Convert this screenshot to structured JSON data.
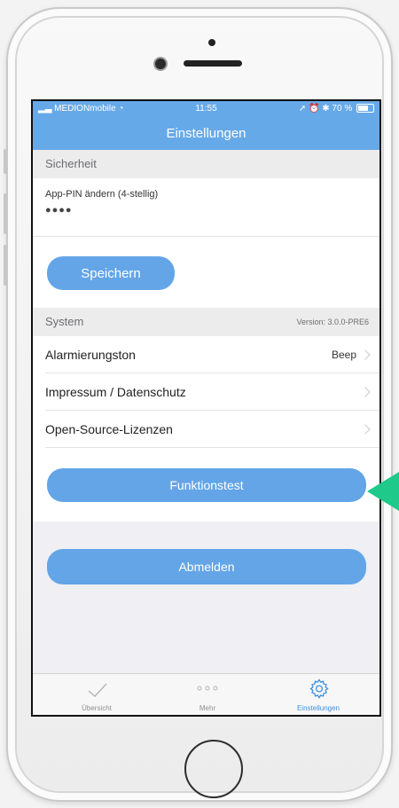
{
  "status_bar": {
    "carrier": "MEDIONmobile",
    "time": "11:55",
    "battery": "70 %",
    "battery_level": 0.7
  },
  "nav": {
    "title": "Einstellungen"
  },
  "security_section": {
    "header": "Sicherheit",
    "pin_label": "App-PIN ändern (4-stellig)",
    "pin_value": "●●●●",
    "save_button": "Speichern"
  },
  "system_section": {
    "header": "System",
    "version": "Version: 3.0.0-PRE6",
    "rows": [
      {
        "label": "Alarmierungston",
        "detail": "Beep"
      },
      {
        "label": "Impressum / Datenschutz",
        "detail": ""
      },
      {
        "label": "Open-Source-Lizenzen",
        "detail": ""
      }
    ],
    "test_button": "Funktionstest"
  },
  "logout_button": "Abmelden",
  "tabs": [
    {
      "label": "Übersicht",
      "icon": "checkmark-icon"
    },
    {
      "label": "Mehr",
      "icon": "more-dots-icon"
    },
    {
      "label": "Einstellungen",
      "icon": "gear-icon",
      "active": true
    }
  ],
  "colors": {
    "accent": "#66a9e8",
    "button": "#63a5e7",
    "highlight_arrow": "#1fc98a"
  }
}
